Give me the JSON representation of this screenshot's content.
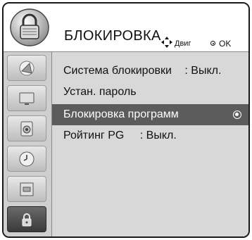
{
  "header": {
    "icon": "padlock-icon",
    "title": "БЛОКИРОВКА",
    "hint_move_icon": "four-way-arrows-icon",
    "hint_move": "Двиг",
    "hint_ok_icon": "ok-dot-icon",
    "hint_ok": "OK"
  },
  "sidebar": {
    "items": [
      {
        "icon": "satellite-dish-icon",
        "active": false
      },
      {
        "icon": "tv-screen-icon",
        "active": false
      },
      {
        "icon": "speaker-icon",
        "active": false
      },
      {
        "icon": "clock-icon",
        "active": false
      },
      {
        "icon": "options-box-icon",
        "active": false
      },
      {
        "icon": "padlock-icon",
        "active": true
      }
    ]
  },
  "menu": {
    "items": [
      {
        "label": "Система блокировки",
        "value": ": Выкл."
      },
      {
        "label": "Устан. пароль",
        "value": ""
      },
      {
        "label": "Блокировка программ",
        "value": "",
        "selected": true
      },
      {
        "label": "Ройтинг PG",
        "value": ": Выкл."
      }
    ]
  },
  "colors": {
    "header_bg": "#ffffff",
    "panel_bg": "#d8d8d8",
    "selected_bg": "#5c5c5c",
    "frame_border": "#1a1a1a"
  }
}
